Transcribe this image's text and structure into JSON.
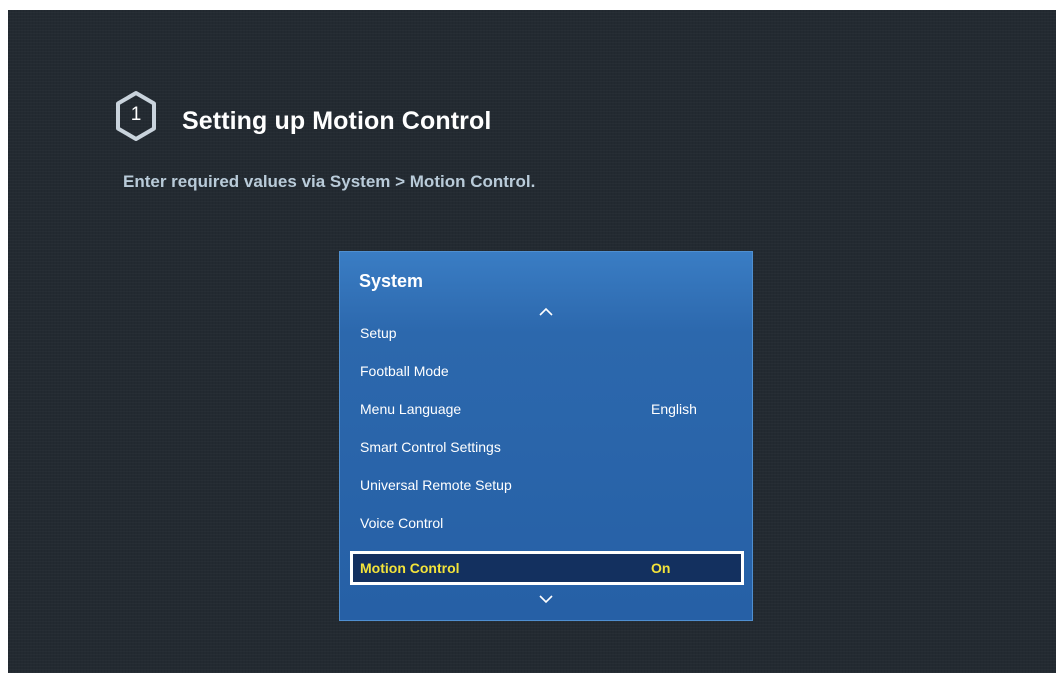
{
  "step": {
    "number": "1",
    "title": "Setting up Motion Control",
    "instruction": "Enter required values via System > Motion Control."
  },
  "panel": {
    "title": "System",
    "scroll_up_icon": "chevron-up-icon",
    "scroll_down_icon": "chevron-down-icon",
    "items": [
      {
        "label": "Setup",
        "value": ""
      },
      {
        "label": "Football Mode",
        "value": ""
      },
      {
        "label": "Menu Language",
        "value": "English"
      },
      {
        "label": "Smart Control Settings",
        "value": ""
      },
      {
        "label": "Universal Remote Setup",
        "value": ""
      },
      {
        "label": "Voice Control",
        "value": ""
      },
      {
        "label": "Motion Control",
        "value": "On",
        "selected": true
      }
    ]
  },
  "colors": {
    "background": "#232a31",
    "panel": "#2c68ad",
    "selected_background": "#13305f",
    "selected_text": "#f3e33a",
    "instruction_text": "#b9cbd9"
  }
}
